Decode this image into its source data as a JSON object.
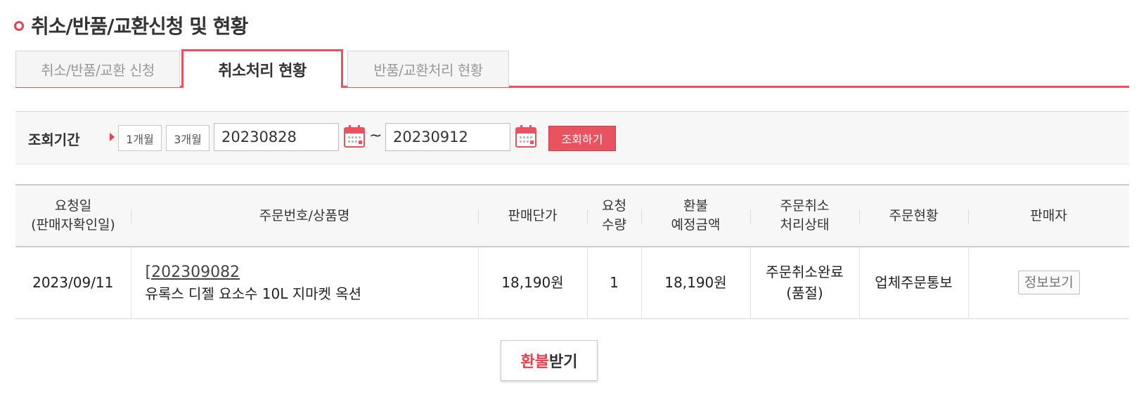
{
  "page": {
    "title": "취소/반품/교환신청 및 현황"
  },
  "tabs": [
    {
      "label": "취소/반품/교환 신청",
      "active": false
    },
    {
      "label": "취소처리 현황",
      "active": true
    },
    {
      "label": "반품/교환처리 현황",
      "active": false
    }
  ],
  "search": {
    "label": "조회기간",
    "period_1m": "1개월",
    "period_3m": "3개월",
    "date_from": "20230828",
    "date_separator": "~",
    "date_to": "20230912",
    "submit_label": "조회하기",
    "calendar_icon": "calendar-icon"
  },
  "table": {
    "headers": [
      {
        "line1": "요청일",
        "line2": "(판매자확인일)"
      },
      {
        "line1": "주문번호/상품명",
        "line2": ""
      },
      {
        "line1": "판매단가",
        "line2": ""
      },
      {
        "line1": "요청",
        "line2": "수량"
      },
      {
        "line1": "환불",
        "line2": "예정금액"
      },
      {
        "line1": "주문취소",
        "line2": "처리상태"
      },
      {
        "line1": "주문현황",
        "line2": ""
      },
      {
        "line1": "판매자",
        "line2": ""
      }
    ],
    "rows": [
      {
        "request_date": "2023/09/11",
        "order_number": "[202309082",
        "product_name": "유록스 디젤 요소수 10L 지마켓 옥션",
        "unit_price": "18,190원",
        "quantity": "1",
        "refund_amount": "18,190원",
        "status_line1": "주문취소완료",
        "status_line2": "(품절)",
        "order_status": "업체주문통보",
        "seller_button": "정보보기"
      }
    ]
  },
  "refund": {
    "label_red": "환불",
    "label_dark": "받기"
  },
  "colors": {
    "accent": "#e8535f",
    "bullet": "#e8404f"
  }
}
